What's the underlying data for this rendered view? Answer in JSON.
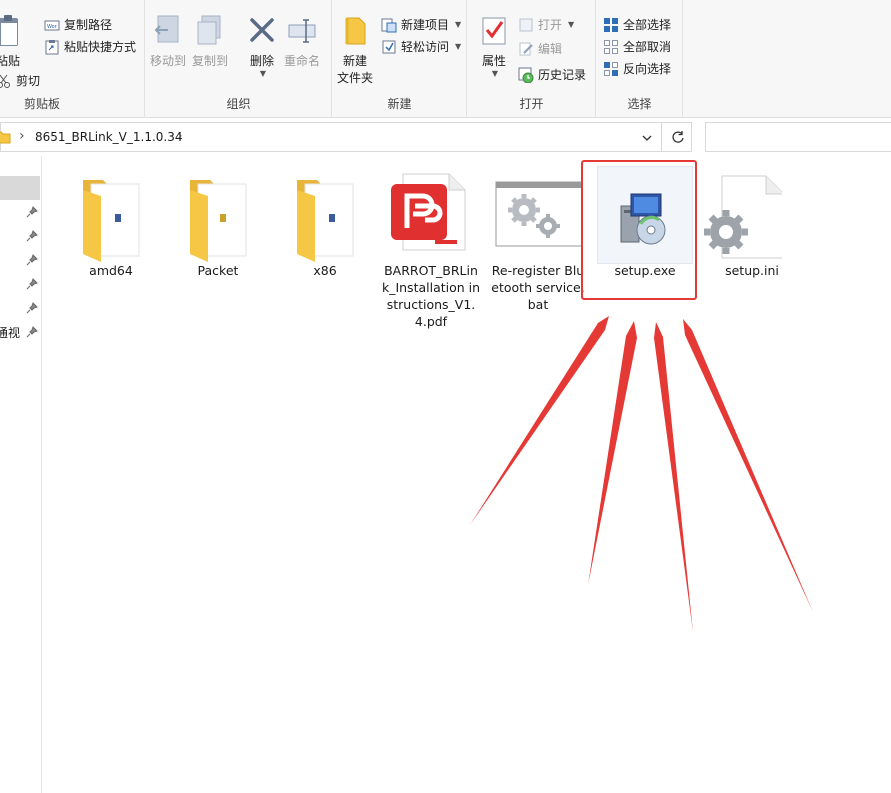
{
  "ribbon": {
    "clipboard": {
      "paste_label": "粘贴",
      "copy_path_label": "复制路径",
      "paste_shortcut_label": "粘贴快捷方式",
      "cut_label": "剪切",
      "group_label": "剪贴板"
    },
    "organize": {
      "move_to_label": "移动到",
      "copy_to_label": "复制到",
      "delete_label": "删除",
      "rename_label": "重命名",
      "group_label": "组织"
    },
    "new": {
      "new_folder_line1": "新建",
      "new_folder_line2": "文件夹",
      "new_item_label": "新建项目",
      "easy_access_label": "轻松访问",
      "group_label": "新建"
    },
    "open": {
      "properties_label": "属性",
      "open_label": "打开",
      "edit_label": "编辑",
      "history_label": "历史记录",
      "group_label": "打开"
    },
    "select": {
      "select_all_label": "全部选择",
      "select_none_label": "全部取消",
      "invert_label": "反向选择",
      "group_label": "选择"
    }
  },
  "address": {
    "path": "8651_BRLink_V_1.1.0.34",
    "separator": "›"
  },
  "nav": {
    "partial_item": "通视"
  },
  "files": [
    {
      "name": "amd64",
      "type": "folder"
    },
    {
      "name": "Packet",
      "type": "folder"
    },
    {
      "name": "x86",
      "type": "folder"
    },
    {
      "name": "BARROT_BRLink_Installation instructions_V1.4.pdf",
      "type": "pdf"
    },
    {
      "name": "Re-register Bluetooth service.bat",
      "type": "bat"
    },
    {
      "name": "setup.exe",
      "type": "exe"
    },
    {
      "name": "setup.ini",
      "type": "ini"
    }
  ],
  "colors": {
    "highlight": "#e53935",
    "arrow": "#e53935",
    "folder": "#f5c744",
    "pdf": "#e0302f"
  }
}
